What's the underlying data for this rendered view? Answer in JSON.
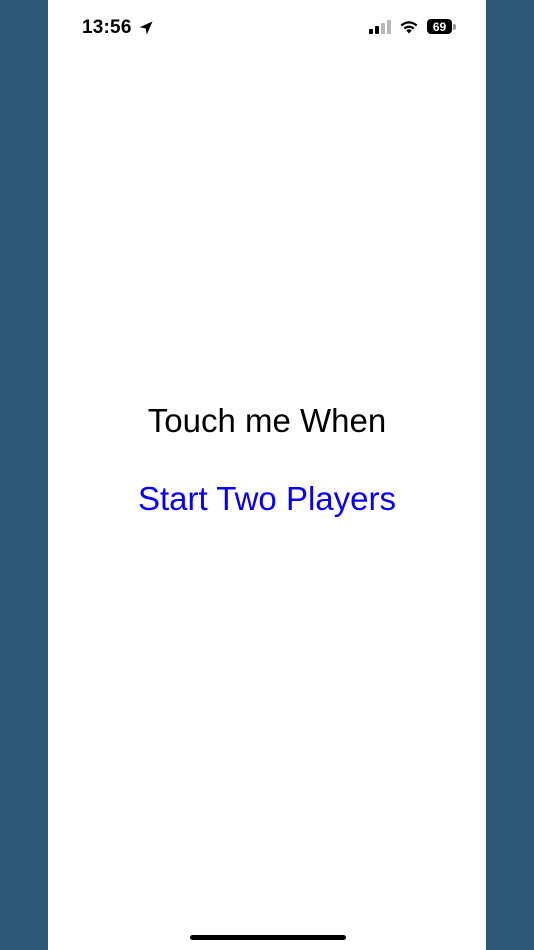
{
  "status_bar": {
    "time": "13:56",
    "location_icon": "location-arrow-icon",
    "signal_icon": "cellular-signal-icon",
    "wifi_icon": "wifi-icon",
    "battery_level": "69"
  },
  "main": {
    "prompt": "Touch me When",
    "start_link": "Start Two Players"
  },
  "colors": {
    "side_background": "#2d5878",
    "screen_background": "#ffffff",
    "link": "#0a00f0",
    "text": "#000000"
  }
}
